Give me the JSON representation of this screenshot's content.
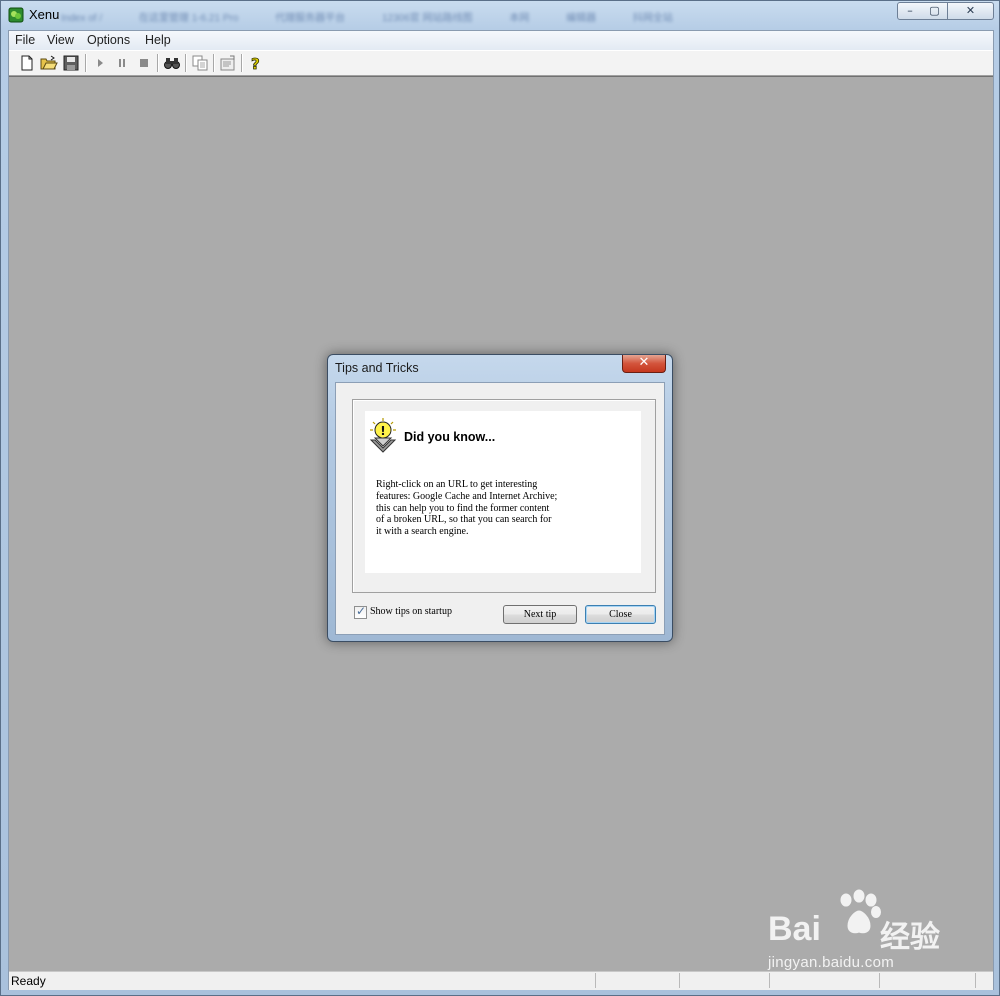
{
  "window": {
    "title": "Xenu",
    "background_tabs": [
      "Index of /",
      "在这里管理 1-6.21 Pro",
      "代理服务器平台",
      "12306官 网站路线图",
      "本网",
      "编辑器",
      "抖网全站"
    ],
    "caption_buttons": {
      "minimize": "–",
      "maximize": "▢",
      "close": "✕"
    }
  },
  "menu": {
    "items": [
      "File",
      "View",
      "Options",
      "Help"
    ]
  },
  "toolbar": {
    "buttons": [
      "new-document-icon",
      "open-folder-icon",
      "save-icon",
      "play-icon",
      "pause-icon",
      "stop-icon",
      "binoculars-icon",
      "copy-icon",
      "properties-icon",
      "help-icon"
    ]
  },
  "status": {
    "text": "Ready"
  },
  "dialog": {
    "title": "Tips and Tricks",
    "close_glyph": "✕",
    "heading": "Did you know...",
    "tip_lines": [
      "Right-click on an URL to get interesting",
      "features: Google Cache and Internet Archive;",
      "this can help you to find the former content",
      "of a broken URL, so that you can search for",
      "it with a search engine."
    ],
    "checkbox_label": "Show tips on startup",
    "checkbox_checked": true,
    "checkmark": "✓",
    "next_button": "Next tip",
    "close_button": "Close"
  },
  "watermark": {
    "brand": "Bai",
    "brand_cn": "经验",
    "url": "jingyan.baidu.com"
  },
  "colors": {
    "workspace": "#ababab",
    "dialog_close": "#c5381f",
    "title_gradient": "#b6cde6"
  }
}
